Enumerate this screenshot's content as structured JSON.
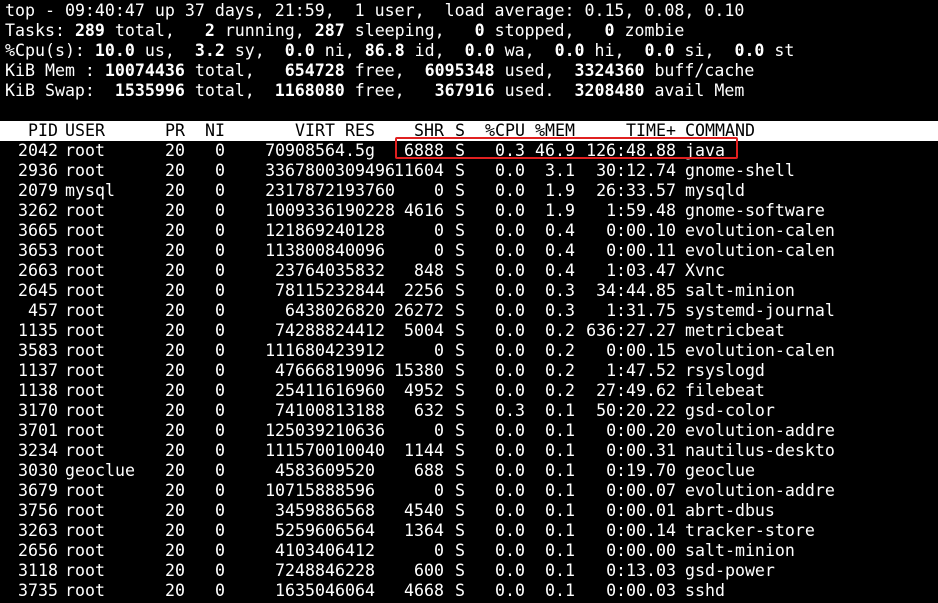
{
  "summary": {
    "top_prefix": "top - ",
    "time": "09:40:47",
    "uptime_text": " up 37 days, 21:59,  1 user,  load average: 0.15, 0.08, 0.10",
    "tasks_label": "Tasks: ",
    "tasks_total": "289",
    "tasks_total_label": " total,   ",
    "tasks_running": "2",
    "tasks_running_label": " running, ",
    "tasks_sleeping": "287",
    "tasks_sleeping_label": " sleeping,   ",
    "tasks_stopped": "0",
    "tasks_stopped_label": " stopped,   ",
    "tasks_zombie": "0",
    "tasks_zombie_label": " zombie",
    "cpu_label": "%Cpu(s): ",
    "cpu_us": "10.0",
    "cpu_us_label": " us,  ",
    "cpu_sy": "3.2",
    "cpu_sy_label": " sy,  ",
    "cpu_ni": "0.0",
    "cpu_ni_label": " ni, ",
    "cpu_id": "86.8",
    "cpu_id_label": " id,  ",
    "cpu_wa": "0.0",
    "cpu_wa_label": " wa,  ",
    "cpu_hi": "0.0",
    "cpu_hi_label": " hi,  ",
    "cpu_si": "0.0",
    "cpu_si_label": " si,  ",
    "cpu_st": "0.0",
    "cpu_st_label": " st",
    "mem_label": "KiB Mem : ",
    "mem_total": "10074436",
    "mem_total_label": " total,   ",
    "mem_free": "654728",
    "mem_free_label": " free,  ",
    "mem_used": "6095348",
    "mem_used_label": " used,  ",
    "mem_cache": "3324360",
    "mem_cache_label": " buff/cache",
    "swap_label": "KiB Swap:  ",
    "swap_total": "1535996",
    "swap_total_label": " total,  ",
    "swap_free": "1168080",
    "swap_free_label": " free,   ",
    "swap_used": "367916",
    "swap_used_label": " used.  ",
    "swap_avail": "3208480",
    "swap_avail_label": " avail Mem"
  },
  "columns": {
    "pid": "PID",
    "user": "USER",
    "pr": "PR",
    "ni": "NI",
    "virt": "VIRT",
    "res": "RES",
    "shr": "SHR",
    "s": "S",
    "cpu": "%CPU",
    "mem": "%MEM",
    "time": "TIME+",
    "cmd": "COMMAND"
  },
  "processes": [
    {
      "pid": "2042",
      "user": "root",
      "pr": "20",
      "ni": "0",
      "virt": "7090856",
      "res": "4.5g",
      "shr": "6888",
      "s": "S",
      "cpu": "0.3",
      "mem": "46.9",
      "time": "126:48.88",
      "cmd": "java"
    },
    {
      "pid": "2936",
      "user": "root",
      "pr": "20",
      "ni": "0",
      "virt": "3367800",
      "res": "309496",
      "shr": "11604",
      "s": "S",
      "cpu": "0.0",
      "mem": "3.1",
      "time": "30:12.74",
      "cmd": "gnome-shell"
    },
    {
      "pid": "2079",
      "user": "mysql",
      "pr": "20",
      "ni": "0",
      "virt": "2317872",
      "res": "193760",
      "shr": "0",
      "s": "S",
      "cpu": "0.0",
      "mem": "1.9",
      "time": "26:33.57",
      "cmd": "mysqld"
    },
    {
      "pid": "3262",
      "user": "root",
      "pr": "20",
      "ni": "0",
      "virt": "1009336",
      "res": "190228",
      "shr": "4616",
      "s": "S",
      "cpu": "0.0",
      "mem": "1.9",
      "time": "1:59.48",
      "cmd": "gnome-software"
    },
    {
      "pid": "3665",
      "user": "root",
      "pr": "20",
      "ni": "0",
      "virt": "1218692",
      "res": "40128",
      "shr": "0",
      "s": "S",
      "cpu": "0.0",
      "mem": "0.4",
      "time": "0:00.10",
      "cmd": "evolution-calen"
    },
    {
      "pid": "3653",
      "user": "root",
      "pr": "20",
      "ni": "0",
      "virt": "1138008",
      "res": "40096",
      "shr": "0",
      "s": "S",
      "cpu": "0.0",
      "mem": "0.4",
      "time": "0:00.11",
      "cmd": "evolution-calen"
    },
    {
      "pid": "2663",
      "user": "root",
      "pr": "20",
      "ni": "0",
      "virt": "237640",
      "res": "35832",
      "shr": "848",
      "s": "S",
      "cpu": "0.0",
      "mem": "0.4",
      "time": "1:03.47",
      "cmd": "Xvnc"
    },
    {
      "pid": "2645",
      "user": "root",
      "pr": "20",
      "ni": "0",
      "virt": "781152",
      "res": "32844",
      "shr": "2256",
      "s": "S",
      "cpu": "0.0",
      "mem": "0.3",
      "time": "34:44.85",
      "cmd": "salt-minion"
    },
    {
      "pid": "457",
      "user": "root",
      "pr": "20",
      "ni": "0",
      "virt": "64380",
      "res": "26820",
      "shr": "26272",
      "s": "S",
      "cpu": "0.0",
      "mem": "0.3",
      "time": "1:31.75",
      "cmd": "systemd-journal"
    },
    {
      "pid": "1135",
      "user": "root",
      "pr": "20",
      "ni": "0",
      "virt": "742888",
      "res": "24412",
      "shr": "5004",
      "s": "S",
      "cpu": "0.0",
      "mem": "0.2",
      "time": "636:27.27",
      "cmd": "metricbeat"
    },
    {
      "pid": "3583",
      "user": "root",
      "pr": "20",
      "ni": "0",
      "virt": "1116804",
      "res": "23912",
      "shr": "0",
      "s": "S",
      "cpu": "0.0",
      "mem": "0.2",
      "time": "0:00.15",
      "cmd": "evolution-calen"
    },
    {
      "pid": "1137",
      "user": "root",
      "pr": "20",
      "ni": "0",
      "virt": "476668",
      "res": "19096",
      "shr": "15380",
      "s": "S",
      "cpu": "0.0",
      "mem": "0.2",
      "time": "1:47.52",
      "cmd": "rsyslogd"
    },
    {
      "pid": "1138",
      "user": "root",
      "pr": "20",
      "ni": "0",
      "virt": "254116",
      "res": "16960",
      "shr": "4952",
      "s": "S",
      "cpu": "0.0",
      "mem": "0.2",
      "time": "27:49.62",
      "cmd": "filebeat"
    },
    {
      "pid": "3170",
      "user": "root",
      "pr": "20",
      "ni": "0",
      "virt": "741008",
      "res": "13188",
      "shr": "632",
      "s": "S",
      "cpu": "0.3",
      "mem": "0.1",
      "time": "50:20.22",
      "cmd": "gsd-color"
    },
    {
      "pid": "3701",
      "user": "root",
      "pr": "20",
      "ni": "0",
      "virt": "1250392",
      "res": "10636",
      "shr": "0",
      "s": "S",
      "cpu": "0.0",
      "mem": "0.1",
      "time": "0:00.20",
      "cmd": "evolution-addre"
    },
    {
      "pid": "3234",
      "user": "root",
      "pr": "20",
      "ni": "0",
      "virt": "1115700",
      "res": "10040",
      "shr": "1144",
      "s": "S",
      "cpu": "0.0",
      "mem": "0.1",
      "time": "0:00.31",
      "cmd": "nautilus-deskto"
    },
    {
      "pid": "3030",
      "user": "geoclue",
      "pr": "20",
      "ni": "0",
      "virt": "458360",
      "res": "9520",
      "shr": "688",
      "s": "S",
      "cpu": "0.0",
      "mem": "0.1",
      "time": "0:19.70",
      "cmd": "geoclue"
    },
    {
      "pid": "3679",
      "user": "root",
      "pr": "20",
      "ni": "0",
      "virt": "1071588",
      "res": "8596",
      "shr": "0",
      "s": "S",
      "cpu": "0.0",
      "mem": "0.1",
      "time": "0:00.07",
      "cmd": "evolution-addre"
    },
    {
      "pid": "3756",
      "user": "root",
      "pr": "20",
      "ni": "0",
      "virt": "345988",
      "res": "6568",
      "shr": "4540",
      "s": "S",
      "cpu": "0.0",
      "mem": "0.1",
      "time": "0:00.01",
      "cmd": "abrt-dbus"
    },
    {
      "pid": "3263",
      "user": "root",
      "pr": "20",
      "ni": "0",
      "virt": "525960",
      "res": "6564",
      "shr": "1364",
      "s": "S",
      "cpu": "0.0",
      "mem": "0.1",
      "time": "0:00.14",
      "cmd": "tracker-store"
    },
    {
      "pid": "2656",
      "user": "root",
      "pr": "20",
      "ni": "0",
      "virt": "410340",
      "res": "6412",
      "shr": "0",
      "s": "S",
      "cpu": "0.0",
      "mem": "0.1",
      "time": "0:00.00",
      "cmd": "salt-minion"
    },
    {
      "pid": "3118",
      "user": "root",
      "pr": "20",
      "ni": "0",
      "virt": "724884",
      "res": "6228",
      "shr": "600",
      "s": "S",
      "cpu": "0.0",
      "mem": "0.1",
      "time": "0:13.03",
      "cmd": "gsd-power"
    },
    {
      "pid": "3735",
      "user": "root",
      "pr": "20",
      "ni": "0",
      "virt": "163504",
      "res": "6064",
      "shr": "4668",
      "s": "S",
      "cpu": "0.0",
      "mem": "0.1",
      "time": "0:00.03",
      "cmd": "sshd"
    }
  ],
  "highlight_color": "#e02020"
}
